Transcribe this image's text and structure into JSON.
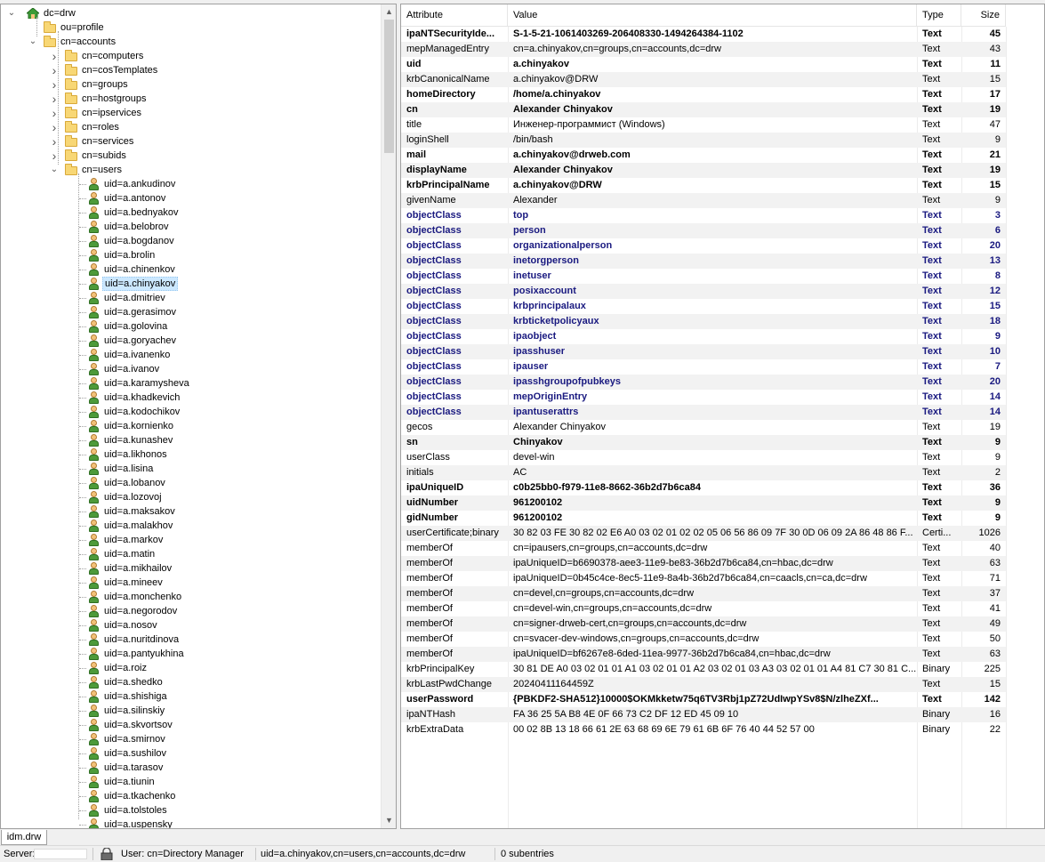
{
  "tree": {
    "root": "dc=drw",
    "nodes": [
      {
        "label": "ou=profile",
        "level": 1,
        "kind": "folder",
        "expander": "none"
      },
      {
        "label": "cn=accounts",
        "level": 1,
        "kind": "folder",
        "expander": "expanded"
      },
      {
        "label": "cn=computers",
        "level": 2,
        "kind": "folder",
        "expander": "collapsed"
      },
      {
        "label": "cn=cosTemplates",
        "level": 2,
        "kind": "folder",
        "expander": "collapsed"
      },
      {
        "label": "cn=groups",
        "level": 2,
        "kind": "folder",
        "expander": "collapsed"
      },
      {
        "label": "cn=hostgroups",
        "level": 2,
        "kind": "folder",
        "expander": "collapsed"
      },
      {
        "label": "cn=ipservices",
        "level": 2,
        "kind": "folder",
        "expander": "collapsed"
      },
      {
        "label": "cn=roles",
        "level": 2,
        "kind": "folder",
        "expander": "collapsed"
      },
      {
        "label": "cn=services",
        "level": 2,
        "kind": "folder",
        "expander": "collapsed"
      },
      {
        "label": "cn=subids",
        "level": 2,
        "kind": "folder",
        "expander": "collapsed"
      },
      {
        "label": "cn=users",
        "level": 2,
        "kind": "folder",
        "expander": "expanded"
      },
      {
        "label": "uid=a.ankudinov",
        "level": 3,
        "kind": "user"
      },
      {
        "label": "uid=a.antonov",
        "level": 3,
        "kind": "user"
      },
      {
        "label": "uid=a.bednyakov",
        "level": 3,
        "kind": "user"
      },
      {
        "label": "uid=a.belobrov",
        "level": 3,
        "kind": "user"
      },
      {
        "label": "uid=a.bogdanov",
        "level": 3,
        "kind": "user"
      },
      {
        "label": "uid=a.brolin",
        "level": 3,
        "kind": "user"
      },
      {
        "label": "uid=a.chinenkov",
        "level": 3,
        "kind": "user"
      },
      {
        "label": "uid=a.chinyakov",
        "level": 3,
        "kind": "user",
        "selected": true
      },
      {
        "label": "uid=a.dmitriev",
        "level": 3,
        "kind": "user"
      },
      {
        "label": "uid=a.gerasimov",
        "level": 3,
        "kind": "user"
      },
      {
        "label": "uid=a.golovina",
        "level": 3,
        "kind": "user"
      },
      {
        "label": "uid=a.goryachev",
        "level": 3,
        "kind": "user"
      },
      {
        "label": "uid=a.ivanenko",
        "level": 3,
        "kind": "user"
      },
      {
        "label": "uid=a.ivanov",
        "level": 3,
        "kind": "user"
      },
      {
        "label": "uid=a.karamysheva",
        "level": 3,
        "kind": "user"
      },
      {
        "label": "uid=a.khadkevich",
        "level": 3,
        "kind": "user"
      },
      {
        "label": "uid=a.kodochikov",
        "level": 3,
        "kind": "user"
      },
      {
        "label": "uid=a.kornienko",
        "level": 3,
        "kind": "user"
      },
      {
        "label": "uid=a.kunashev",
        "level": 3,
        "kind": "user"
      },
      {
        "label": "uid=a.likhonos",
        "level": 3,
        "kind": "user"
      },
      {
        "label": "uid=a.lisina",
        "level": 3,
        "kind": "user"
      },
      {
        "label": "uid=a.lobanov",
        "level": 3,
        "kind": "user"
      },
      {
        "label": "uid=a.lozovoj",
        "level": 3,
        "kind": "user"
      },
      {
        "label": "uid=a.maksakov",
        "level": 3,
        "kind": "user"
      },
      {
        "label": "uid=a.malakhov",
        "level": 3,
        "kind": "user"
      },
      {
        "label": "uid=a.markov",
        "level": 3,
        "kind": "user"
      },
      {
        "label": "uid=a.matin",
        "level": 3,
        "kind": "user"
      },
      {
        "label": "uid=a.mikhailov",
        "level": 3,
        "kind": "user"
      },
      {
        "label": "uid=a.mineev",
        "level": 3,
        "kind": "user"
      },
      {
        "label": "uid=a.monchenko",
        "level": 3,
        "kind": "user"
      },
      {
        "label": "uid=a.negorodov",
        "level": 3,
        "kind": "user"
      },
      {
        "label": "uid=a.nosov",
        "level": 3,
        "kind": "user"
      },
      {
        "label": "uid=a.nuritdinova",
        "level": 3,
        "kind": "user"
      },
      {
        "label": "uid=a.pantyukhina",
        "level": 3,
        "kind": "user"
      },
      {
        "label": "uid=a.roiz",
        "level": 3,
        "kind": "user"
      },
      {
        "label": "uid=a.shedko",
        "level": 3,
        "kind": "user"
      },
      {
        "label": "uid=a.shishiga",
        "level": 3,
        "kind": "user"
      },
      {
        "label": "uid=a.silinskiy",
        "level": 3,
        "kind": "user"
      },
      {
        "label": "uid=a.skvortsov",
        "level": 3,
        "kind": "user"
      },
      {
        "label": "uid=a.smirnov",
        "level": 3,
        "kind": "user"
      },
      {
        "label": "uid=a.sushilov",
        "level": 3,
        "kind": "user"
      },
      {
        "label": "uid=a.tarasov",
        "level": 3,
        "kind": "user"
      },
      {
        "label": "uid=a.tiunin",
        "level": 3,
        "kind": "user"
      },
      {
        "label": "uid=a.tkachenko",
        "level": 3,
        "kind": "user"
      },
      {
        "label": "uid=a.tolstoles",
        "level": 3,
        "kind": "user"
      },
      {
        "label": "uid=a.uspensky",
        "level": 3,
        "kind": "user"
      }
    ]
  },
  "grid": {
    "columns": {
      "attribute": "Attribute",
      "value": "Value",
      "type": "Type",
      "size": "Size"
    },
    "rows": [
      {
        "attribute": "ipaNTSecurityIde...",
        "value": "S-1-5-21-1061403269-206408330-1494264384-1102",
        "type": "Text",
        "size": "45",
        "style": "bold"
      },
      {
        "attribute": "mepManagedEntry",
        "value": "cn=a.chinyakov,cn=groups,cn=accounts,dc=drw",
        "type": "Text",
        "size": "43",
        "style": "normal"
      },
      {
        "attribute": "uid",
        "value": "a.chinyakov",
        "type": "Text",
        "size": "11",
        "style": "bold"
      },
      {
        "attribute": "krbCanonicalName",
        "value": "a.chinyakov@DRW",
        "type": "Text",
        "size": "15",
        "style": "normal"
      },
      {
        "attribute": "homeDirectory",
        "value": "/home/a.chinyakov",
        "type": "Text",
        "size": "17",
        "style": "bold"
      },
      {
        "attribute": "cn",
        "value": "Alexander Chinyakov",
        "type": "Text",
        "size": "19",
        "style": "bold"
      },
      {
        "attribute": "title",
        "value": "Инженер-программист (Windows)",
        "type": "Text",
        "size": "47",
        "style": "normal"
      },
      {
        "attribute": "loginShell",
        "value": "/bin/bash",
        "type": "Text",
        "size": "9",
        "style": "normal"
      },
      {
        "attribute": "mail",
        "value": "a.chinyakov@drweb.com",
        "type": "Text",
        "size": "21",
        "style": "bold"
      },
      {
        "attribute": "displayName",
        "value": "Alexander Chinyakov",
        "type": "Text",
        "size": "19",
        "style": "bold"
      },
      {
        "attribute": "krbPrincipalName",
        "value": "a.chinyakov@DRW",
        "type": "Text",
        "size": "15",
        "style": "bold"
      },
      {
        "attribute": "givenName",
        "value": "Alexander",
        "type": "Text",
        "size": "9",
        "style": "normal"
      },
      {
        "attribute": "objectClass",
        "value": "top",
        "type": "Text",
        "size": "3",
        "style": "objc"
      },
      {
        "attribute": "objectClass",
        "value": "person",
        "type": "Text",
        "size": "6",
        "style": "objc"
      },
      {
        "attribute": "objectClass",
        "value": "organizationalperson",
        "type": "Text",
        "size": "20",
        "style": "objc"
      },
      {
        "attribute": "objectClass",
        "value": "inetorgperson",
        "type": "Text",
        "size": "13",
        "style": "objc"
      },
      {
        "attribute": "objectClass",
        "value": "inetuser",
        "type": "Text",
        "size": "8",
        "style": "objc"
      },
      {
        "attribute": "objectClass",
        "value": "posixaccount",
        "type": "Text",
        "size": "12",
        "style": "objc"
      },
      {
        "attribute": "objectClass",
        "value": "krbprincipalaux",
        "type": "Text",
        "size": "15",
        "style": "objc"
      },
      {
        "attribute": "objectClass",
        "value": "krbticketpolicyaux",
        "type": "Text",
        "size": "18",
        "style": "objc"
      },
      {
        "attribute": "objectClass",
        "value": "ipaobject",
        "type": "Text",
        "size": "9",
        "style": "objc"
      },
      {
        "attribute": "objectClass",
        "value": "ipasshuser",
        "type": "Text",
        "size": "10",
        "style": "objc"
      },
      {
        "attribute": "objectClass",
        "value": "ipauser",
        "type": "Text",
        "size": "7",
        "style": "objc"
      },
      {
        "attribute": "objectClass",
        "value": "ipasshgroupofpubkeys",
        "type": "Text",
        "size": "20",
        "style": "objc"
      },
      {
        "attribute": "objectClass",
        "value": "mepOriginEntry",
        "type": "Text",
        "size": "14",
        "style": "objc"
      },
      {
        "attribute": "objectClass",
        "value": "ipantuserattrs",
        "type": "Text",
        "size": "14",
        "style": "objc"
      },
      {
        "attribute": "gecos",
        "value": "Alexander Chinyakov",
        "type": "Text",
        "size": "19",
        "style": "normal"
      },
      {
        "attribute": "sn",
        "value": "Chinyakov",
        "type": "Text",
        "size": "9",
        "style": "bold"
      },
      {
        "attribute": "userClass",
        "value": "devel-win",
        "type": "Text",
        "size": "9",
        "style": "normal"
      },
      {
        "attribute": "initials",
        "value": "AC",
        "type": "Text",
        "size": "2",
        "style": "normal"
      },
      {
        "attribute": "ipaUniqueID",
        "value": "c0b25bb0-f979-11e8-8662-36b2d7b6ca84",
        "type": "Text",
        "size": "36",
        "style": "bold"
      },
      {
        "attribute": "uidNumber",
        "value": "961200102",
        "type": "Text",
        "size": "9",
        "style": "bold"
      },
      {
        "attribute": "gidNumber",
        "value": "961200102",
        "type": "Text",
        "size": "9",
        "style": "bold"
      },
      {
        "attribute": "userCertificate;binary",
        "value": "30 82 03 FE 30 82 02 E6 A0 03 02 01 02 02 05 06 56 86 09 7F 30 0D 06 09 2A 86 48 86 F...",
        "type": "Certi...",
        "size": "1026",
        "style": "normal"
      },
      {
        "attribute": "memberOf",
        "value": "cn=ipausers,cn=groups,cn=accounts,dc=drw",
        "type": "Text",
        "size": "40",
        "style": "normal"
      },
      {
        "attribute": "memberOf",
        "value": "ipaUniqueID=b6690378-aee3-11e9-be83-36b2d7b6ca84,cn=hbac,dc=drw",
        "type": "Text",
        "size": "63",
        "style": "normal"
      },
      {
        "attribute": "memberOf",
        "value": "ipaUniqueID=0b45c4ce-8ec5-11e9-8a4b-36b2d7b6ca84,cn=caacls,cn=ca,dc=drw",
        "type": "Text",
        "size": "71",
        "style": "normal"
      },
      {
        "attribute": "memberOf",
        "value": "cn=devel,cn=groups,cn=accounts,dc=drw",
        "type": "Text",
        "size": "37",
        "style": "normal"
      },
      {
        "attribute": "memberOf",
        "value": "cn=devel-win,cn=groups,cn=accounts,dc=drw",
        "type": "Text",
        "size": "41",
        "style": "normal"
      },
      {
        "attribute": "memberOf",
        "value": "cn=signer-drweb-cert,cn=groups,cn=accounts,dc=drw",
        "type": "Text",
        "size": "49",
        "style": "normal"
      },
      {
        "attribute": "memberOf",
        "value": "cn=svacer-dev-windows,cn=groups,cn=accounts,dc=drw",
        "type": "Text",
        "size": "50",
        "style": "normal"
      },
      {
        "attribute": "memberOf",
        "value": "ipaUniqueID=bf6267e8-6ded-11ea-9977-36b2d7b6ca84,cn=hbac,dc=drw",
        "type": "Text",
        "size": "63",
        "style": "normal"
      },
      {
        "attribute": "krbPrincipalKey",
        "value": "30 81 DE A0 03 02 01 01 A1 03 02 01 01 A2 03 02 01 03 A3 03 02 01 01 A4 81 C7 30 81 C...",
        "type": "Binary",
        "size": "225",
        "style": "normal"
      },
      {
        "attribute": "krbLastPwdChange",
        "value": "20240411164459Z",
        "type": "Text",
        "size": "15",
        "style": "normal"
      },
      {
        "attribute": "userPassword",
        "value": "{PBKDF2-SHA512}10000$OKMkketw75q6TV3Rbj1pZ72UdIwpYSv8$N/zlheZXf...",
        "type": "Text",
        "size": "142",
        "style": "bold"
      },
      {
        "attribute": "ipaNTHash",
        "value": "FA 36 25 5A B8 4E 0F 66 73 C2 DF 12 ED 45 09 10",
        "type": "Binary",
        "size": "16",
        "style": "normal"
      },
      {
        "attribute": "krbExtraData",
        "value": "00 02 8B 13 18 66 61 2E 63 68 69 6E 79 61 6B 6F 76 40 44 52 57 00",
        "type": "Binary",
        "size": "22",
        "style": "normal"
      }
    ]
  },
  "bottom": {
    "tab_label": "idm.drw",
    "server_label": "Server:",
    "user_label": "User: cn=Directory Manager",
    "dn_label": "uid=a.chinyakov,cn=users,cn=accounts,dc=drw",
    "subentries_label": "0 subentries"
  },
  "colors": {
    "selection": "#cce8ff",
    "objectclass_text": "#1a1a80",
    "alt_row": "#f2f2f2"
  }
}
